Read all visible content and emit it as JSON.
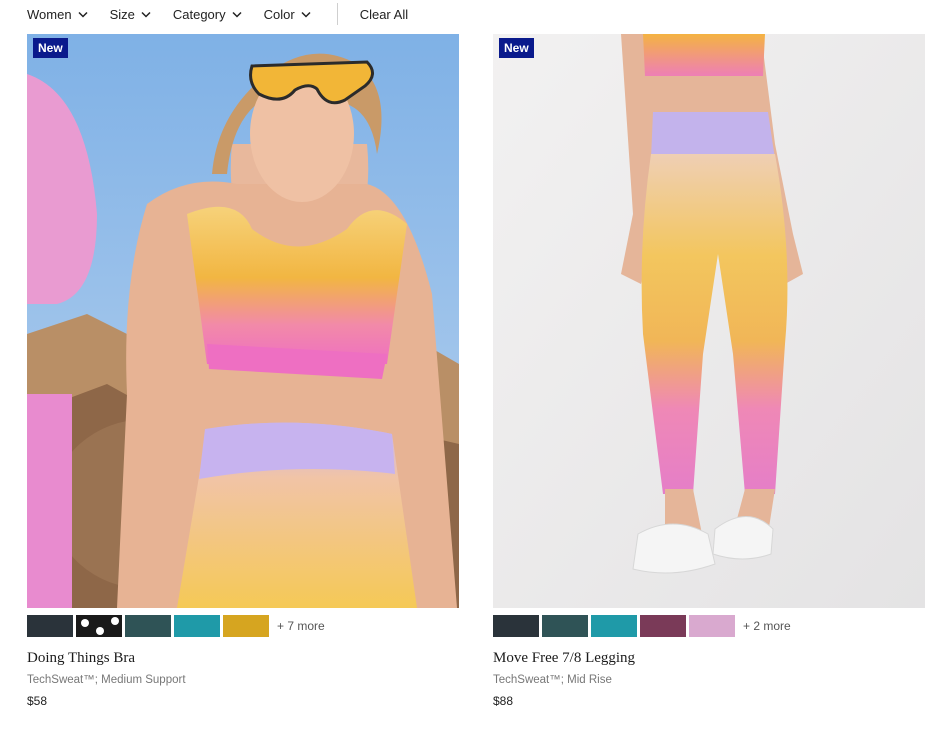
{
  "filters": [
    {
      "label": "Women"
    },
    {
      "label": "Size"
    },
    {
      "label": "Category"
    },
    {
      "label": "Color"
    }
  ],
  "clear_all": "Clear All",
  "products": [
    {
      "badge": "New",
      "name": "Doing Things Bra",
      "subtitle": "TechSweat™; Medium Support",
      "price": "$58",
      "swatches": [
        "#2a333a",
        "#1a1a1a",
        "#2f5356",
        "#1f9aa8",
        "#d6a520"
      ],
      "more": "+ 7 more"
    },
    {
      "badge": "New",
      "name": "Move Free 7/8 Legging",
      "subtitle": "TechSweat™; Mid Rise",
      "price": "$88",
      "swatches": [
        "#2a333a",
        "#2f5356",
        "#1f9aa8",
        "#7a3a58",
        "#d9a9cf"
      ],
      "more": "+ 2 more"
    }
  ]
}
